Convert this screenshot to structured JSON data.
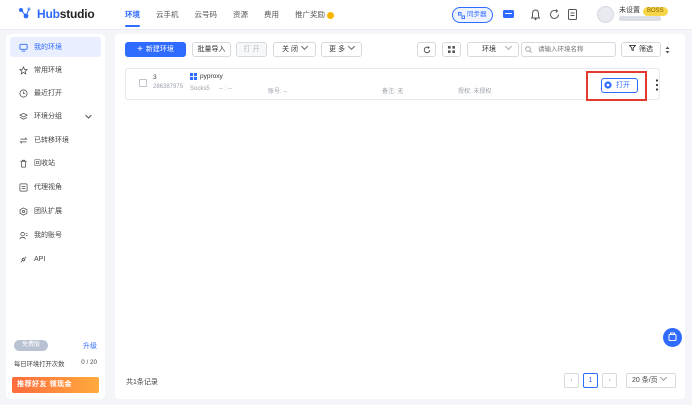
{
  "brand": {
    "name_prefix": "Hub",
    "name_suffix": "studio"
  },
  "nav": {
    "items": [
      {
        "label": "环境",
        "active": true
      },
      {
        "label": "云手机"
      },
      {
        "label": "云号码"
      },
      {
        "label": "资源"
      },
      {
        "label": "费用"
      },
      {
        "label": "推广奖励"
      }
    ]
  },
  "topbar": {
    "sync_label": "同步器",
    "user_name": "未设置",
    "user_badge": "BOSS"
  },
  "sidebar": {
    "items": [
      {
        "label": "我的环境",
        "icon": "monitor-icon",
        "active": true
      },
      {
        "label": "常用环境",
        "icon": "star-icon"
      },
      {
        "label": "最近打开",
        "icon": "clock-icon"
      },
      {
        "label": "环境分组",
        "icon": "layers-icon"
      },
      {
        "label": "已转移环境",
        "icon": "transfer-icon"
      },
      {
        "label": "回收站",
        "icon": "trash-icon"
      },
      {
        "label": "代理视角",
        "icon": "proxy-icon"
      },
      {
        "label": "团队扩展",
        "icon": "team-icon"
      },
      {
        "label": "我的账号",
        "icon": "user-icon"
      },
      {
        "label": "API",
        "icon": "api-icon"
      }
    ],
    "plan": {
      "tag": "免费版",
      "upgrade": "升级",
      "daily_label": "每日环境打开次数",
      "daily_value": "0 / 20"
    },
    "promo": "推荐好友 领现金"
  },
  "toolbar": {
    "new_env": "新建环境",
    "batch_import": "批量导入",
    "open": "打 开",
    "close": "关 闭",
    "more": "更 多",
    "env_select": "环境",
    "search_placeholder": "请输入环境名称",
    "filter": "筛选"
  },
  "table": {
    "rows": [
      {
        "index": "3",
        "id": "286387975",
        "name": "pyproxy",
        "proxy": "Socks5",
        "proxy_extra": "--  :  --",
        "account": "账号: --",
        "note": "备注: 无",
        "auth": "授权: 未授权",
        "action": "打开"
      }
    ]
  },
  "footer": {
    "total": "共1条记录",
    "page": "1",
    "page_size": "20 条/页"
  },
  "colors": {
    "accent": "#2f6bff",
    "highlight": "#e23a2f"
  }
}
